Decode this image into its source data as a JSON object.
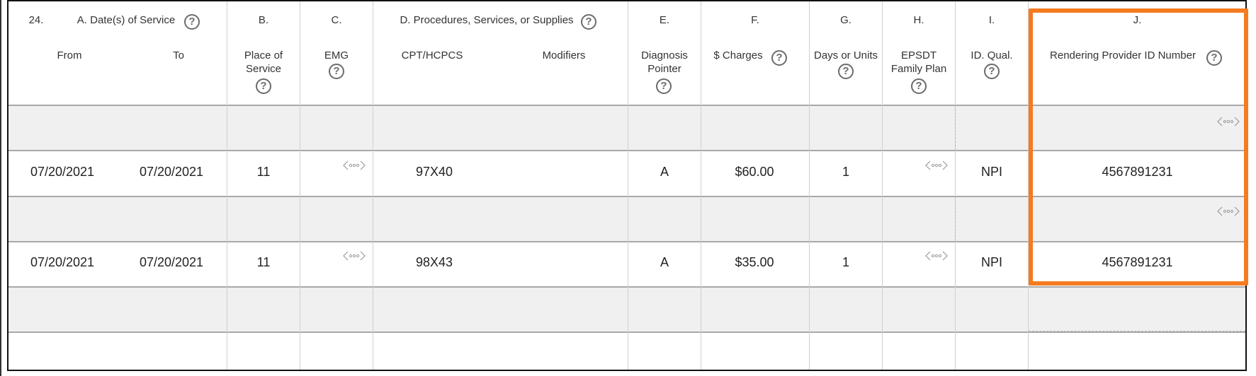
{
  "header": {
    "line_number": "24.",
    "col_a": {
      "letter": "A. Date(s) of Service",
      "from": "From",
      "to": "To"
    },
    "col_b": {
      "letter": "B.",
      "label": "Place of Service"
    },
    "col_c": {
      "letter": "C.",
      "label": "EMG"
    },
    "col_d": {
      "letter": "D. Procedures, Services, or Supplies",
      "cpt": "CPT/HCPCS",
      "modifiers": "Modifiers"
    },
    "col_e": {
      "letter": "E.",
      "label": "Diagnosis Pointer"
    },
    "col_f": {
      "letter": "F.",
      "label": "$ Charges"
    },
    "col_g": {
      "letter": "G.",
      "label": "Days or Units"
    },
    "col_h": {
      "letter": "H.",
      "label": "EPSDT Family Plan"
    },
    "col_i": {
      "letter": "I.",
      "label": "ID. Qual."
    },
    "col_j": {
      "letter": "J.",
      "label": "Rendering Provider ID Number"
    },
    "help_glyph": "?"
  },
  "rows": [
    {
      "from": "07/20/2021",
      "to": "07/20/2021",
      "place": "11",
      "emg": "",
      "cpt": "97X40",
      "modifiers": "",
      "pointer": "A",
      "charges": "$60.00",
      "units": "1",
      "epsdt": "",
      "qual": "NPI",
      "provider_id": "4567891231"
    },
    {
      "from": "07/20/2021",
      "to": "07/20/2021",
      "place": "11",
      "emg": "",
      "cpt": "98X43",
      "modifiers": "",
      "pointer": "A",
      "charges": "$35.00",
      "units": "1",
      "epsdt": "",
      "qual": "NPI",
      "provider_id": "4567891231"
    }
  ],
  "icons": {
    "more": "more-options-icon",
    "help": "help-circle-icon"
  },
  "colors": {
    "highlight": "#f47b20",
    "shaded_row": "#f0f0f0",
    "border": "#111111"
  }
}
